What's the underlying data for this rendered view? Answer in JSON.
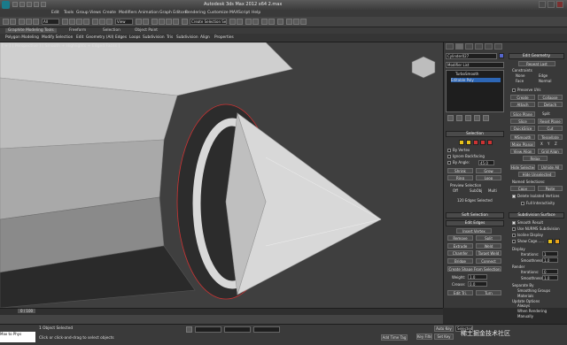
{
  "window": {
    "title": "Autodesk 3ds Max 2012 x64   2.max"
  },
  "menu": [
    "Edit",
    "Tools",
    "Group",
    "Views",
    "Create",
    "Modifiers",
    "Animation",
    "Graph Editors",
    "Rendering",
    "Customize",
    "MAXScript",
    "Help"
  ],
  "toolbar": {
    "selection_filter": "All",
    "ref_coord": "View",
    "named_selection": "Create Selection Se"
  },
  "ribbon": {
    "tabs": [
      "Graphite Modeling Tools",
      "Freeform",
      "Selection",
      "Object Paint"
    ],
    "subtabs": [
      "Polygon Modeling",
      "Modify Selection",
      "Edit",
      "Geometry (All)",
      "Edges",
      "Loops",
      "Subdivision",
      "Tris",
      "Subdivision",
      "Align",
      "Properties"
    ]
  },
  "viewport": {
    "label": "[ + ] [ Perspective ] [ Smooth + Highlights + Edged Faces ]"
  },
  "command_panel": {
    "object_name": "Cylinder027",
    "modifier_list": "Modifier List",
    "stack": [
      "TurboSmooth",
      "Editable Poly"
    ],
    "selection": {
      "title": "Selection",
      "by_vertex": "By Vertex",
      "ignore_backfacing": "Ignore Backfacing",
      "by_angle": "By Angle:",
      "by_angle_value": "45.0",
      "shrink": "Shrink",
      "grow": "Grow",
      "ring": "Ring",
      "loop": "Loop",
      "preview_selection": "Preview Selection",
      "preview_opts": [
        "Off",
        "SubObj",
        "Multi"
      ],
      "status": "120 Edges Selected"
    },
    "soft_selection": {
      "title": "Soft Selection"
    },
    "edit_edges": {
      "title": "Edit Edges",
      "insert_vertex": "Insert Vertex",
      "remove": "Remove",
      "split": "Split",
      "extrude": "Extrude",
      "weld": "Weld",
      "chamfer": "Chamfer",
      "target_weld": "Target Weld",
      "bridge": "Bridge",
      "connect": "Connect",
      "create_shape": "Create Shape From Selection",
      "weight": "Weight:",
      "weight_val": "1.0",
      "crease": "Crease:",
      "crease_val": "0.0",
      "edit_tri": "Edit Tri.",
      "turn": "Turn"
    },
    "edit_geometry": {
      "title": "Edit Geometry",
      "repeat_last": "Repeat Last",
      "constraints": "Constraints",
      "c_opts": [
        "None",
        "Edge",
        "Face",
        "Normal"
      ],
      "preserve_uvs": "Preserve UVs",
      "create": "Create",
      "collapse": "Collapse",
      "attach": "Attach",
      "detach": "Detach",
      "slice_plane": "Slice Plane",
      "split": "Split",
      "slice": "Slice",
      "reset_plane": "Reset Plane",
      "quickslice": "QuickSlice",
      "cut": "Cut",
      "msmooth": "MSmooth",
      "tessellate": "Tessellate",
      "make_planar": "Make Planar",
      "xyz": [
        "X",
        "Y",
        "Z"
      ],
      "view_align": "View Align",
      "grid_align": "Grid Align",
      "relax": "Relax",
      "hide_selected": "Hide Selected",
      "unhide_all": "Unhide All",
      "hide_unselected": "Hide Unselected",
      "named_selections": "Named Selections:",
      "copy": "Copy",
      "paste": "Paste",
      "delete_isolated": "Delete Isolated Vertices",
      "full_interactivity": "Full Interactivity"
    },
    "subdivision_surface": {
      "title": "Subdivision Surface",
      "smooth_result": "Smooth Result",
      "use_nurms": "Use NURMS Subdivision",
      "isoline_display": "Isoline Display",
      "show_cage": "Show Cage......",
      "display": "Display",
      "iterations": "Iterations:",
      "iterations_val": "1",
      "smoothness": "Smoothness:",
      "smoothness_val": "1.0",
      "render": "Render",
      "r_iterations": "Iterations:",
      "r_iterations_val": "0",
      "r_smoothness": "Smoothness:",
      "r_smoothness_val": "1.0",
      "separate_by": "Separate By",
      "smoothing_groups": "Smoothing Groups",
      "materials": "Materials",
      "update_options": "Update Options",
      "always": "Always",
      "when_rendering": "When Rendering",
      "manually": "Manually"
    }
  },
  "timeline": {
    "frame": "0 / 100"
  },
  "status": {
    "script": "Max to Phys",
    "selected": "1 Object Selected",
    "prompt": "Click or click-and-drag to select objects",
    "auto_key": "Auto Key",
    "set_key": "Set Key",
    "key_filters": "Key Filters...",
    "add_time_tag": "Add Time Tag",
    "selected_dd": "Selected"
  },
  "watermark": "稀土掘金技术社区",
  "colors": {
    "accent_red": "#cc3333",
    "stack_highlight": "#2d66b5",
    "yellow": "#e8c21a"
  }
}
